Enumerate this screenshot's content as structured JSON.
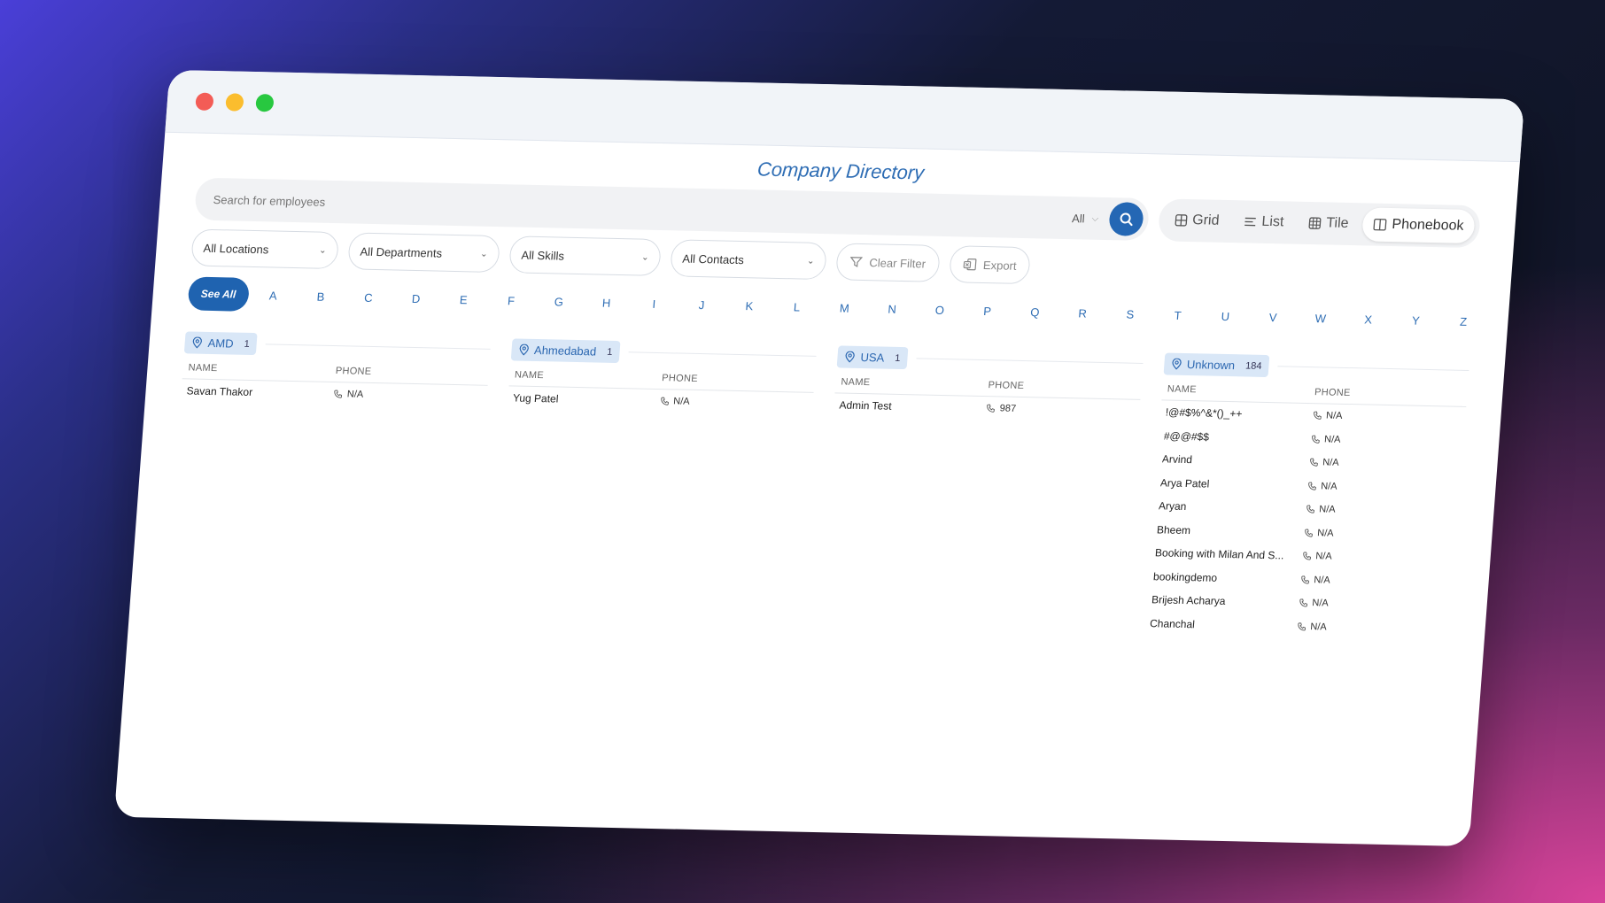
{
  "page": {
    "title": "Company Directory"
  },
  "search": {
    "placeholder": "Search for employees",
    "scope": "All"
  },
  "views": [
    {
      "label": "Grid",
      "icon": "grid-icon"
    },
    {
      "label": "List",
      "icon": "list-icon"
    },
    {
      "label": "Tile",
      "icon": "tile-icon"
    },
    {
      "label": "Phonebook",
      "icon": "book-icon",
      "active": true
    }
  ],
  "filters": {
    "locations": "All Locations",
    "departments": "All Departments",
    "skills": "All Skills",
    "contacts": "All Contacts",
    "clear_label": "Clear Filter",
    "export_label": "Export"
  },
  "alphabet": {
    "see_all": "See All",
    "letters": [
      "A",
      "B",
      "C",
      "D",
      "E",
      "F",
      "G",
      "H",
      "I",
      "J",
      "K",
      "L",
      "M",
      "N",
      "O",
      "P",
      "Q",
      "R",
      "S",
      "T",
      "U",
      "V",
      "W",
      "X",
      "Y",
      "Z"
    ]
  },
  "columns": {
    "name": "NAME",
    "phone": "PHONE"
  },
  "groups": [
    {
      "location": "AMD",
      "count": "1",
      "rows": [
        {
          "name": "Savan Thakor",
          "phone": "N/A"
        }
      ]
    },
    {
      "location": "Ahmedabad",
      "count": "1",
      "rows": [
        {
          "name": "Yug Patel",
          "phone": "N/A"
        }
      ]
    },
    {
      "location": "USA",
      "count": "1",
      "rows": [
        {
          "name": "Admin Test",
          "phone": "987"
        }
      ]
    },
    {
      "location": "Unknown",
      "count": "184",
      "rows": [
        {
          "name": "!@#$%^&*()_++",
          "phone": "N/A"
        },
        {
          "name": "#@@#$$",
          "phone": "N/A"
        },
        {
          "name": "Arvind",
          "phone": "N/A"
        },
        {
          "name": "Arya Patel",
          "phone": "N/A"
        },
        {
          "name": "Aryan",
          "phone": "N/A"
        },
        {
          "name": "Bheem",
          "phone": "N/A"
        },
        {
          "name": "Booking with Milan And S...",
          "phone": "N/A"
        },
        {
          "name": "bookingdemo",
          "phone": "N/A"
        },
        {
          "name": "Brijesh Acharya",
          "phone": "N/A"
        },
        {
          "name": "Chanchal",
          "phone": "N/A"
        }
      ]
    }
  ],
  "colors": {
    "accent": "#2467b4",
    "tag_bg": "#d9e7f7"
  }
}
